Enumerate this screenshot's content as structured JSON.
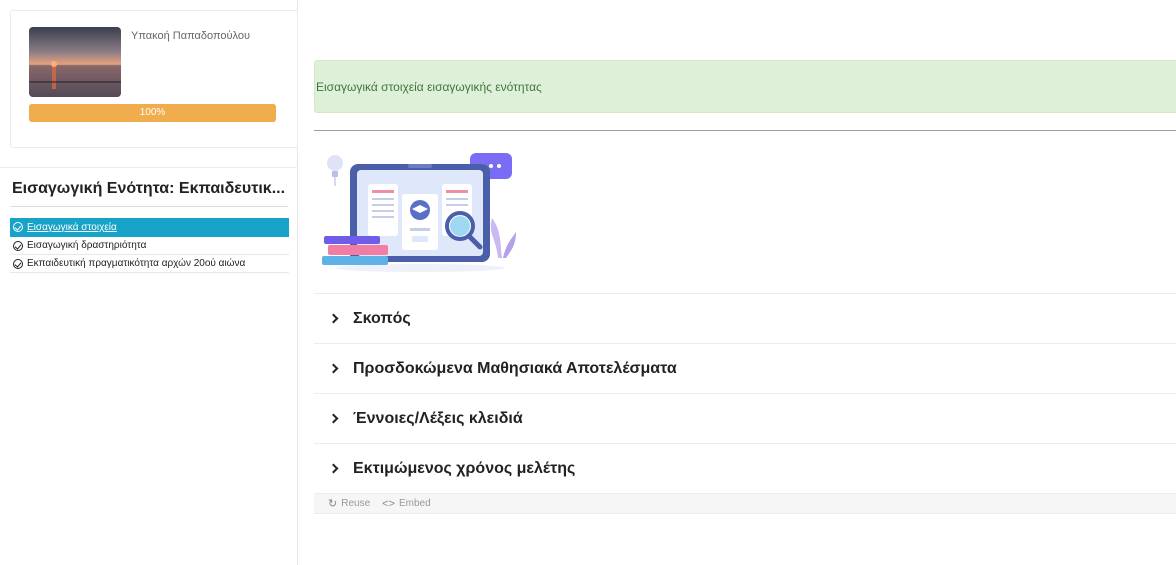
{
  "profile": {
    "name": "Υπακοή Παπαδοπούλου",
    "progress_label": "100%",
    "progress_value": 1.0
  },
  "module": {
    "title": "Εισαγωγική Ενότητα: Εκπαιδευτικ...",
    "lessons": [
      {
        "label": "Εισαγωγικά στοιχεία",
        "active": true
      },
      {
        "label": "Εισαγωγική δραστηριότητα",
        "active": false
      },
      {
        "label": "Εκπαιδευτική πραγματικότητα αρχών 20ού αιώνα",
        "active": false
      }
    ]
  },
  "main": {
    "alert_text": "Εισαγωγικά στοιχεία εισαγωγικής ενότητας",
    "accordion": [
      {
        "title": "Σκοπός"
      },
      {
        "title": "Προσδοκώμενα Μαθησιακά Αποτελέσματα"
      },
      {
        "title": "Έννοιες/Λέξεις κλειδιά"
      },
      {
        "title": "Εκτιμώμενος χρόνος μελέτης"
      }
    ],
    "footer": {
      "reuse_label": "Reuse",
      "embed_label": "Embed"
    }
  },
  "colors": {
    "progress": "#f0ad4e",
    "active_lesson": "#17a2c8",
    "alert_bg": "#dff0d8",
    "alert_text": "#3c763d"
  }
}
